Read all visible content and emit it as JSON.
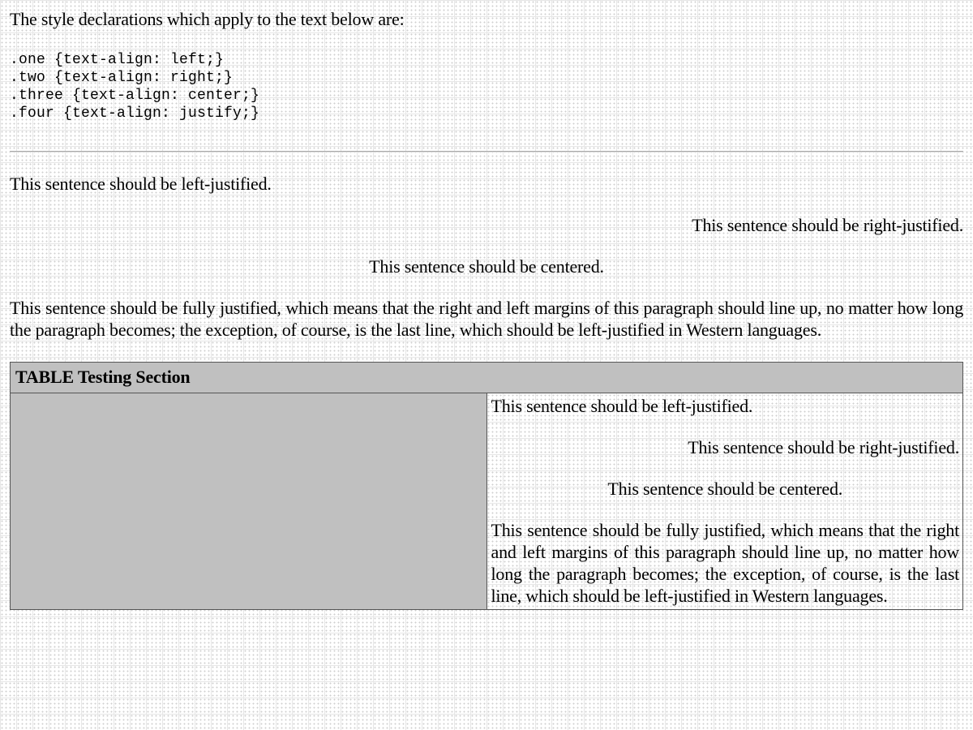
{
  "intro": "The style declarations which apply to the text below are:",
  "code": [
    ".one {text-align: left;}",
    ".two {text-align: right;}",
    ".three {text-align: center;}",
    ".four {text-align: justify;}"
  ],
  "sentences": {
    "left": "This sentence should be left-justified.",
    "right": "This sentence should be right-justified.",
    "center": "This sentence should be centered.",
    "justify": "This sentence should be fully justified, which means that the right and left margins of this paragraph should line up, no matter how long the paragraph becomes; the exception, of course, is the last line, which should be left-justified in Western languages."
  },
  "table": {
    "header": "TABLE Testing Section"
  },
  "colors": {
    "table_shade": "#c0c0c0",
    "border": "#555555"
  }
}
